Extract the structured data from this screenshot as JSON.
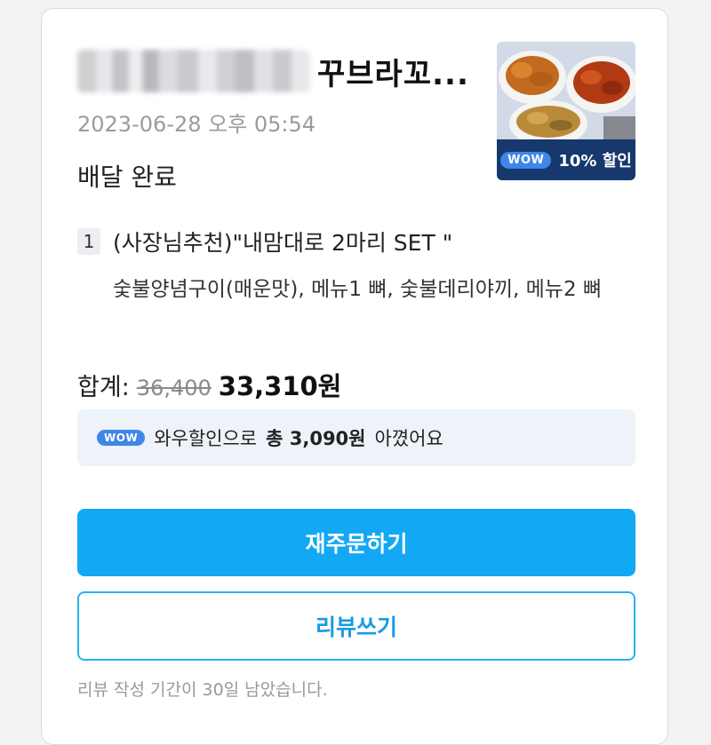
{
  "order": {
    "store_name": "꾸브라꼬...",
    "date": "2023-06-28 오후 05:54",
    "status": "배달 완료",
    "thumbnail": {
      "badge_label": "WOW",
      "discount_text": "10% 할인"
    },
    "item": {
      "quantity": "1",
      "name": "(사장님추천)\"내맘대로 2마리 SET \"",
      "options": "숯불양념구이(매운맛), 메뉴1 뼈, 숯불데리야끼, 메뉴2 뼈"
    },
    "total": {
      "label": "합계:",
      "original_price": "36,400",
      "final_price": "33,310원"
    },
    "savings": {
      "badge_label": "WOW",
      "prefix": "와우할인으로",
      "amount": "총 3,090원",
      "suffix": "아꼈어요"
    },
    "buttons": {
      "reorder": "재주문하기",
      "review": "리뷰쓰기"
    },
    "review_note": "리뷰 작성 기간이 30일 남았습니다."
  },
  "colors": {
    "primary_button": "#13a8f3",
    "review_border": "#2ab1ee",
    "wow_badge": "#3f86e8",
    "thumb_banner": "#16386d",
    "savings_bg": "#eef2f9"
  }
}
